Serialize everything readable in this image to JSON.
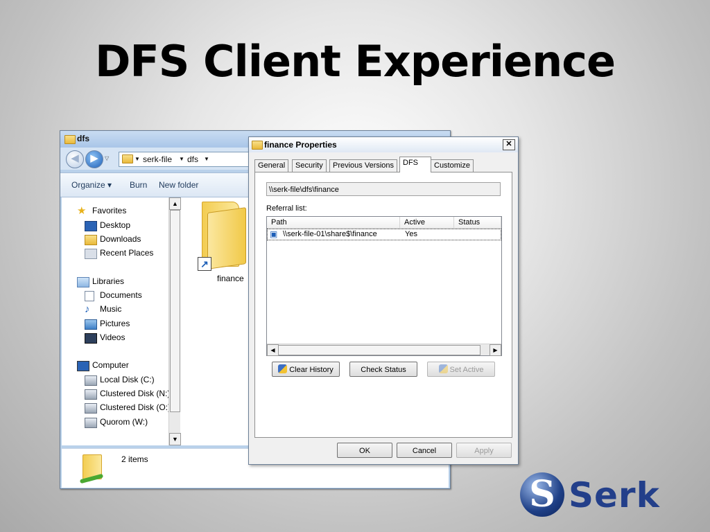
{
  "slide": {
    "title": "DFS Client Experience"
  },
  "explorer": {
    "title": "dfs",
    "breadcrumb": [
      "serk-file",
      "dfs"
    ],
    "toolbar": {
      "organize": "Organize ▾",
      "burn": "Burn",
      "new_folder": "New folder"
    },
    "nav": {
      "favorites": "Favorites",
      "desktop": "Desktop",
      "downloads": "Downloads",
      "recent": "Recent Places",
      "libraries": "Libraries",
      "documents": "Documents",
      "music": "Music",
      "pictures": "Pictures",
      "videos": "Videos",
      "computer": "Computer",
      "local_disk": "Local Disk (C:)",
      "clustered_n": "Clustered Disk (N:)",
      "clustered_o": "Clustered Disk (O:)",
      "quorom": "Quorom (W:)"
    },
    "content": {
      "folder_name": "finance"
    },
    "status": {
      "items": "2 items"
    }
  },
  "properties": {
    "title": "finance Properties",
    "tabs": [
      "General",
      "Security",
      "Previous Versions",
      "DFS",
      "Customize"
    ],
    "active_tab": "DFS",
    "path": "\\\\serk-file\\dfs\\finance",
    "referral_label": "Referral list:",
    "columns": {
      "path": "Path",
      "active": "Active",
      "status": "Status"
    },
    "rows": [
      {
        "path": "\\\\serk-file-01\\share$\\finance",
        "active": "Yes",
        "status": ""
      }
    ],
    "buttons": {
      "clear_history": "Clear History",
      "check_status": "Check Status",
      "set_active": "Set Active",
      "ok": "OK",
      "cancel": "Cancel",
      "apply": "Apply"
    }
  },
  "logo": {
    "text": "Serk"
  }
}
